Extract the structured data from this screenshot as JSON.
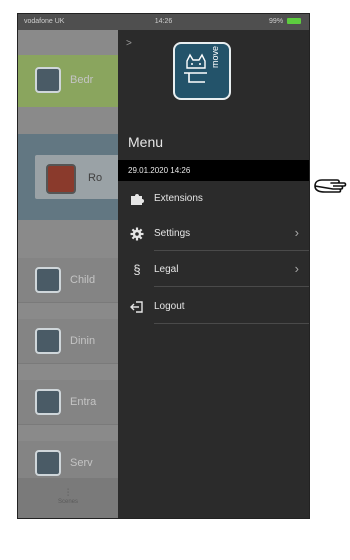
{
  "status_bar": {
    "carrier": "vodafone UK",
    "time": "14:26",
    "battery": "99%"
  },
  "background": {
    "items": [
      {
        "label": "Bedr",
        "icon": "bed-icon"
      },
      {
        "label": "Ro",
        "icon": "room-icon"
      },
      {
        "label": "Child",
        "icon": "child-icon"
      },
      {
        "label": "Dinin",
        "icon": "dining-icon"
      },
      {
        "label": "Entra",
        "icon": "entrance-icon"
      },
      {
        "label": "Serv",
        "icon": "service-icon"
      }
    ],
    "tab_label": "Scenes"
  },
  "menu": {
    "logo_text": "move",
    "title": "Menu",
    "datetime": "29.01.2020 14:26",
    "items": [
      {
        "label": "Extensions",
        "icon": "puzzle-icon",
        "has_chevron": false
      },
      {
        "label": "Settings",
        "icon": "gear-icon",
        "has_chevron": true
      },
      {
        "label": "Legal",
        "icon": "section-icon",
        "has_chevron": true
      },
      {
        "label": "Logout",
        "icon": "logout-icon",
        "has_chevron": false
      }
    ]
  },
  "colors": {
    "logo_bg": "#23536a",
    "datebar_bg": "#000000",
    "drawer_bg": "#2b2b2b"
  }
}
